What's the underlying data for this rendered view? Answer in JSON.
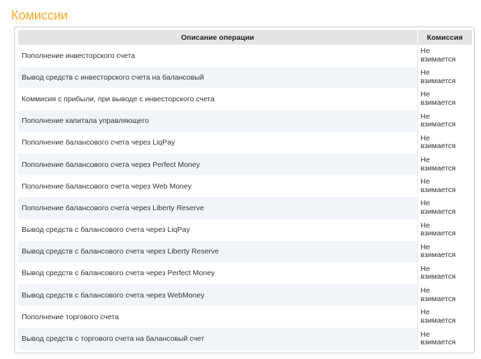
{
  "page": {
    "title": "Комиссии"
  },
  "table": {
    "headers": {
      "description": "Описание операции",
      "fee": "Комиссия"
    },
    "rows": [
      {
        "description": "Пополнение инвесторского счета",
        "fee": "Не взимается"
      },
      {
        "description": "Вывод средств с инвесторского счета на балансовый",
        "fee": "Не взимается"
      },
      {
        "description": "Коммисия с прибыли, при выводе с инвесторского счета",
        "fee": "Не взимается"
      },
      {
        "description": "Пополнение капитала управляющего",
        "fee": "Не взимается"
      },
      {
        "description": "Пополнение балансового счета через LiqPay",
        "fee": "Не взимается"
      },
      {
        "description": "Пополнение балансового счета через Perfect Money",
        "fee": "Не взимается"
      },
      {
        "description": "Пополнение балансового счета через Web Money",
        "fee": "Не взимается"
      },
      {
        "description": "Пополнение балансового счета через Liberty Reserve",
        "fee": "Не взимается"
      },
      {
        "description": "Вывод средств с балансового счета через LiqPay",
        "fee": "Не взимается"
      },
      {
        "description": "Вывод средств с балансового счета через Liberty Reserve",
        "fee": "Не взимается"
      },
      {
        "description": "Вывод средств с балансового счета через Perfect Money",
        "fee": "Не взимается"
      },
      {
        "description": "Вывод средств с балансового счета через WebMoney",
        "fee": "Не взимается"
      },
      {
        "description": "Пополнение торгового счета",
        "fee": "Не взимается"
      },
      {
        "description": "Вывод средств с торгового счета на балансовый счет",
        "fee": "Не взимается"
      }
    ]
  },
  "colors": {
    "title": "#f5a623",
    "header_bg": "#e4e4e4",
    "row_alt_bg": "#f1f5f9",
    "panel_border": "#cfcfcf"
  }
}
